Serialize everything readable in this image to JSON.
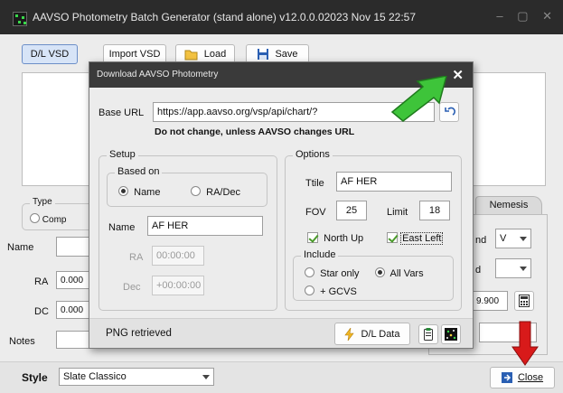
{
  "window": {
    "title": "AAVSO Photometry Batch Generator (stand alone)  v12.0.0.02023 Nov 15  22:57",
    "controls": "– ▢ ✕"
  },
  "toolbar": {
    "dl_vsd": "D/L VSD",
    "import_vsd": "Import VSD",
    "load": "Load",
    "save": "Save"
  },
  "main": {
    "type_legend": "Type",
    "type_comp": "Comp",
    "name_label": "Name",
    "ra_label": "RA",
    "ra_value": "0.000",
    "dc_label": "DC",
    "dc_value": "0.000",
    "notes_label": "Notes",
    "nemesis_tab": "Nemesis",
    "band_label": "nd",
    "band_value": "V",
    "second_label": "d",
    "mag_value": "9.900"
  },
  "bottom": {
    "style_label": "Style",
    "style_value": "Slate Classico",
    "close_label": "Close"
  },
  "dialog": {
    "title": "Download AAVSO Photometry",
    "close": "✕",
    "base_url_label": "Base URL",
    "base_url_value": "https://app.aavso.org/vsp/api/chart/?",
    "warning": "Do not change, unless AAVSO changes URL",
    "setup_legend": "Setup",
    "based_on_legend": "Based on",
    "based_name": "Name",
    "based_radec": "RA/Dec",
    "name_label": "Name",
    "name_value": "AF HER",
    "ra_label": "RA",
    "ra_value": "00:00:00",
    "dec_label": "Dec",
    "dec_value": "+00:00:00",
    "options_legend": "Options",
    "ttile_label": "Ttile",
    "ttile_value": "AF HER",
    "fov_label": "FOV",
    "fov_value": "25",
    "limit_label": "Limit",
    "limit_value": "18",
    "north_up": "North Up",
    "east_left": "East Left",
    "include_legend": "Include",
    "star_only": "Star only",
    "all_vars": "All Vars",
    "gcvs": "+ GCVS",
    "status": "PNG retrieved",
    "dl_data": "D/L Data"
  },
  "colors": {
    "annotation_arrow_green": "#3ec43a",
    "annotation_arrow_red": "#d81a1a",
    "titlebar": "#2b2b2b"
  }
}
